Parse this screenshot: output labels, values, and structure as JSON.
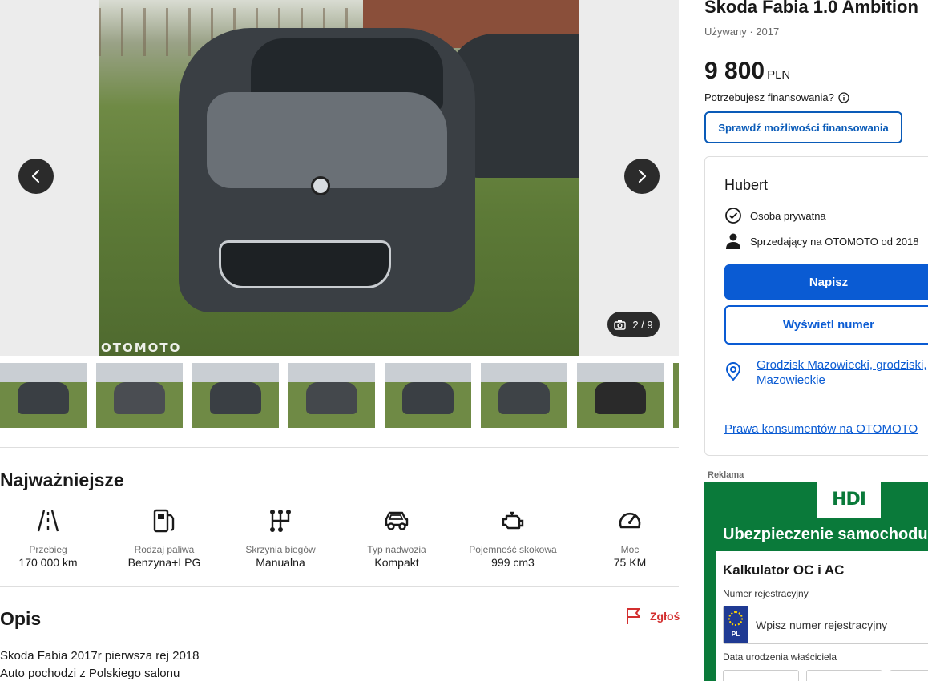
{
  "gallery": {
    "watermark": "OTOMOTO",
    "counter": "2 / 9",
    "thumbnails": [
      {
        "car_color": "#3a3f44"
      },
      {
        "car_color": "#4a4d52"
      },
      {
        "car_color": "#3a3f44"
      },
      {
        "car_color": "#44484c"
      },
      {
        "car_color": "#3a3f44"
      },
      {
        "car_color": "#3e4347"
      },
      {
        "car_color": "#2a2a2a"
      }
    ]
  },
  "highlights": {
    "title": "Najważniejsze",
    "items": [
      {
        "label": "Przebieg",
        "value": "170 000 km",
        "icon": "road-icon"
      },
      {
        "label": "Rodzaj paliwa",
        "value": "Benzyna+LPG",
        "icon": "fuel-pump-icon"
      },
      {
        "label": "Skrzynia biegów",
        "value": "Manualna",
        "icon": "gearbox-icon"
      },
      {
        "label": "Typ nadwozia",
        "value": "Kompakt",
        "icon": "car-body-icon"
      },
      {
        "label": "Pojemność skokowa",
        "value": "999 cm3",
        "icon": "engine-icon"
      },
      {
        "label": "Moc",
        "value": "75 KM",
        "icon": "speedometer-icon"
      }
    ]
  },
  "description": {
    "title": "Opis",
    "report_label": "Zgłoś",
    "lines": [
      "Skoda Fabia 2017r pierwsza rej 2018",
      "Auto pochodzi z Polskiego salonu"
    ]
  },
  "listing": {
    "title": "Skoda Fabia 1.0 Ambition",
    "subtitle": "Używany · 2017",
    "price": "9 800",
    "currency": "PLN",
    "finance_question": "Potrzebujesz finansowania?",
    "finance_button": "Sprawdź możliwości finansowania"
  },
  "seller": {
    "name": "Hubert",
    "type": "Osoba prywatna",
    "since": "Sprzedający na OTOMOTO od 2018",
    "write_button": "Napisz",
    "phone_button": "Wyświetl numer",
    "location": "Grodzisk Mazowiecki, grodziski, Mazowieckie",
    "consumer_rights": "Prawa konsumentów na OTOMOTO"
  },
  "ad": {
    "label": "Reklama",
    "brand": "HDI",
    "headline": "Ubezpieczenie samochodu",
    "form_title": "Kalkulator OC i AC",
    "plate_label": "Numer rejestracyjny",
    "plate_country": "PL",
    "plate_placeholder": "Wpisz numer rejestracyjny",
    "birthdate_label": "Data urodzenia właściciela"
  },
  "colors": {
    "accent": "#0a5bd3",
    "report": "#d32f2f",
    "ad_green": "#0a7a3a"
  }
}
